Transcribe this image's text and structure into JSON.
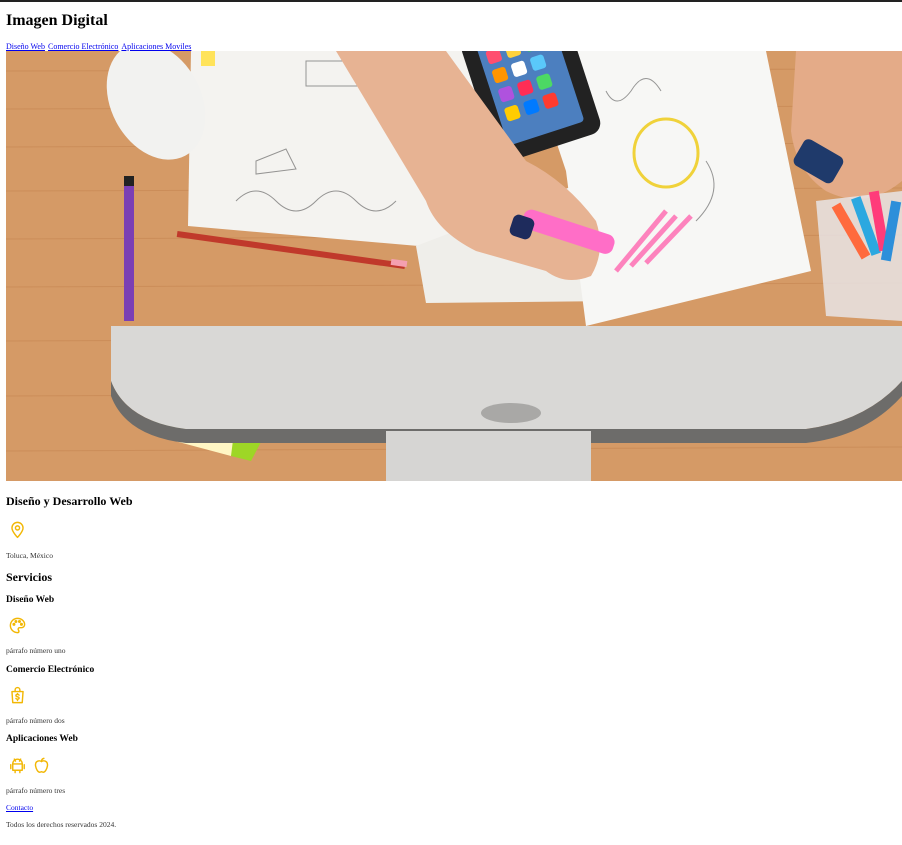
{
  "header": {
    "title": "Imagen Digital"
  },
  "nav": {
    "items": [
      {
        "label": "Diseño Web"
      },
      {
        "label": "Comercio Electrónico"
      },
      {
        "label": "Aplicaciones Moviles"
      }
    ]
  },
  "hero": {
    "alt": "Workspace desk with monitor, phone, pencils and sketches"
  },
  "about": {
    "heading": "Diseño y Desarrollo Web",
    "location_icon": "map-pin-icon",
    "location": "Toluca, México"
  },
  "services": {
    "heading": "Servicios",
    "items": [
      {
        "title": "Diseño Web",
        "icon": "palette-icon",
        "text": "párrafo número uno"
      },
      {
        "title": "Comercio Electrónico",
        "icon": "shopping-bag-icon",
        "text": "párrafo número dos"
      },
      {
        "title": "Aplicaciones Web",
        "icons": [
          "android-icon",
          "apple-icon"
        ],
        "text": "párrafo número tres"
      }
    ]
  },
  "footer": {
    "contact_label": "Contacto",
    "copyright": "Todos los derechos reservados 2024."
  },
  "colors": {
    "accent": "#f2b705",
    "link": "#0000ee"
  }
}
